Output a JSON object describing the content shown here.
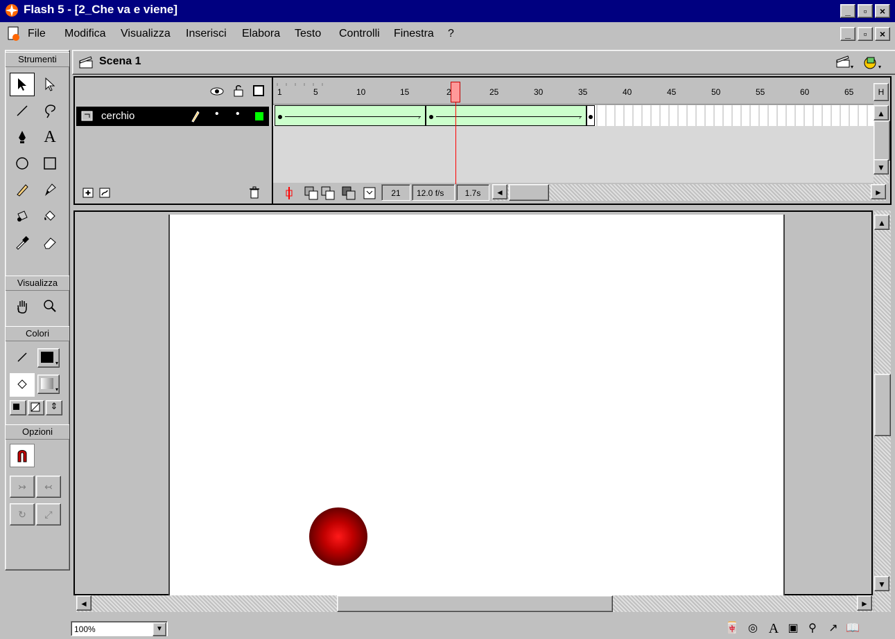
{
  "window": {
    "title": "Flash 5 - [2_Che va e viene]"
  },
  "menu": [
    "File",
    "Modifica",
    "Visualizza",
    "Inserisci",
    "Elabora",
    "Testo",
    "Controlli",
    "Finestra",
    "?"
  ],
  "menu_underline": [
    "F",
    "M",
    "V",
    "I",
    "E",
    "T",
    "C",
    "s",
    "?"
  ],
  "tools": {
    "sections": {
      "strumenti": "Strumenti",
      "visualizza": "Visualizza",
      "colori": "Colori",
      "opzioni": "Opzioni"
    }
  },
  "scene": {
    "label": "Scena 1"
  },
  "timeline": {
    "layer_name": "cerchio",
    "ruler": [
      "1",
      "5",
      "10",
      "15",
      "20",
      "25",
      "30",
      "35",
      "40",
      "45",
      "50",
      "55",
      "60",
      "65"
    ],
    "current_frame": "21",
    "frame_rate": "12.0 f/s",
    "elapsed": "1.7s",
    "right_button": "H"
  },
  "zoom": {
    "value": "100%"
  },
  "colors": {
    "title_bar": "#000080",
    "frame_tween": "#ccffcc",
    "playhead": "#ff0000",
    "layer_active": "#000000"
  }
}
